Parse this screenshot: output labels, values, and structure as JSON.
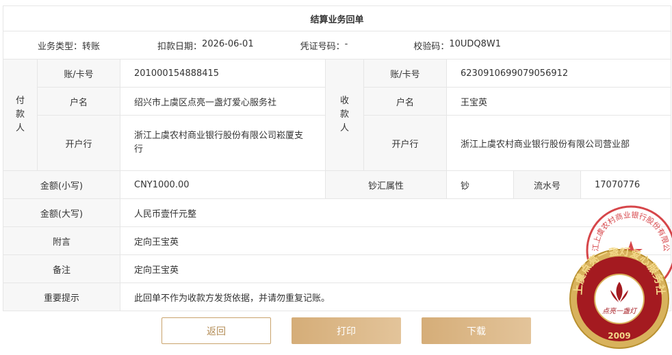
{
  "title": "结算业务回单",
  "meta": {
    "type_label": "业务类型：",
    "type_value": "转账",
    "date_label": "扣款日期：",
    "date_value": "2026-06-01",
    "voucher_label": "凭证号码：",
    "voucher_value": "-",
    "check_label": "校验码：",
    "check_value": "10UDQ8W1"
  },
  "payer": {
    "section": [
      "付",
      "款",
      "人"
    ],
    "account_label": "账/卡号",
    "account": "201000154888415",
    "name_label": "户名",
    "name": "绍兴市上虞区点亮一盏灯爱心服务社",
    "bank_label": "开户行",
    "bank": "浙江上虞农村商业银行股份有限公司崧厦支行"
  },
  "payee": {
    "section": [
      "收",
      "款",
      "人"
    ],
    "account_label": "账/卡号",
    "account": "6230910699079056912",
    "name_label": "户名",
    "name": "王宝英",
    "bank_label": "开户行",
    "bank": "浙江上虞农村商业银行股份有限公司营业部"
  },
  "amount": {
    "small_label": "金额(小写)",
    "small_value": "CNY1000.00",
    "currency_label": "钞汇属性",
    "currency_value": "钞",
    "serial_label": "流水号",
    "serial_value": "17070776",
    "big_label": "金额(大写)",
    "big_value": "人民币壹仟元整"
  },
  "remark": {
    "note_label": "附言",
    "note_value": "定向王宝英",
    "memo_label": "备注",
    "memo_value": "定向王宝英",
    "tip_label": "重要提示",
    "tip_value": "此回单不作为收款方发货依据，并请勿重复记账。"
  },
  "buttons": {
    "back": "返回",
    "print": "打印",
    "download": "下载"
  },
  "stamps": {
    "bank_seal_text": "浙江上虞农村商业银行股份有限公司",
    "org_seal_text": "上虞点亮一盏灯爱心服务社",
    "org_seal_center": "点亮一盏灯",
    "org_seal_year": "2009"
  },
  "colors": {
    "accent": "#c9a36c",
    "seal_red": "#d0262b",
    "label_bg": "#f7f7f7"
  }
}
